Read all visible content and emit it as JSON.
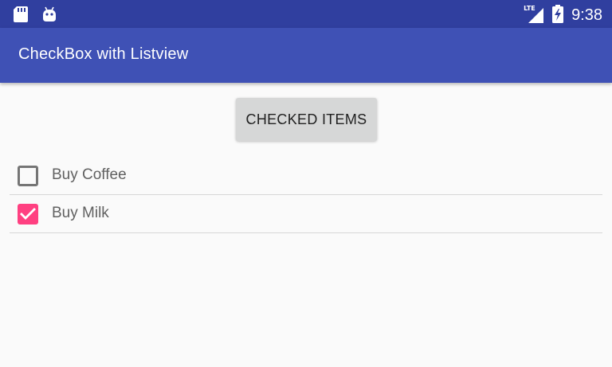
{
  "status_bar": {
    "time": "9:38",
    "network_label": "LTE",
    "left_icons": [
      "sd-card-icon",
      "android-icon"
    ],
    "right_icons": [
      "lte-signal-icon",
      "battery-charging-icon"
    ]
  },
  "app_bar": {
    "title": "CheckBox with Listview"
  },
  "main": {
    "button_label": "CHECKED ITEMS",
    "items": [
      {
        "label": "Buy Coffee",
        "checked": false
      },
      {
        "label": "Buy Milk",
        "checked": true
      }
    ]
  },
  "colors": {
    "status_bar": "#303f9f",
    "app_bar": "#3f51b5",
    "accent": "#ff4081",
    "background": "#fafafa"
  }
}
